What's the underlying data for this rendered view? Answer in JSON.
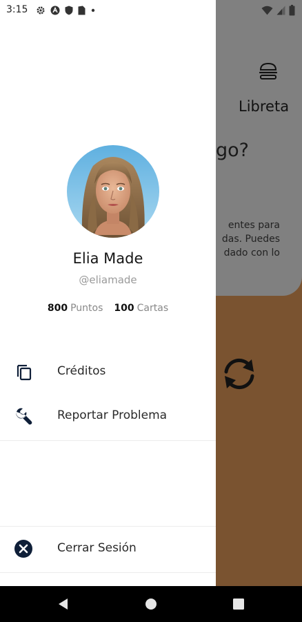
{
  "status_bar": {
    "time": "3:15",
    "left_icons": [
      "settings-icon",
      "autofill-icon",
      "shield-icon",
      "sim-card-icon",
      "dot-icon"
    ],
    "right_icons": [
      "wifi-icon",
      "signal-icon",
      "battery-icon"
    ]
  },
  "background_app": {
    "title": "Libreta",
    "question_fragment": "go?",
    "paragraph_lines": [
      "entes para",
      "das. Puedes",
      "dado con lo"
    ],
    "colors": {
      "scrim_top": "#808080",
      "content_bottom": "#7a5330"
    }
  },
  "drawer": {
    "profile": {
      "name": "Elia Made",
      "handle": "@eliamade",
      "points_value": "800",
      "points_label": "Puntos",
      "cards_value": "100",
      "cards_label": "Cartas"
    },
    "menu": {
      "credits_label": "Créditos",
      "report_label": "Reportar Problema"
    },
    "logout_label": "Cerrar Sesión",
    "colors": {
      "icon_dark": "#0f1f38"
    }
  },
  "nav_bar": {
    "buttons": [
      "back-icon",
      "home-icon",
      "recents-icon"
    ]
  }
}
